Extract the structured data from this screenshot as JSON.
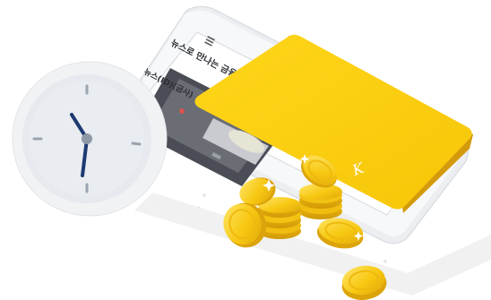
{
  "phone": {
    "screen_title": "뉴스로 만나는 금융",
    "screen_subtitle": "뉴스(ID)(금사)"
  },
  "card": {
    "mark": "K"
  },
  "clock": {
    "hour_hand": "11",
    "minute_hand": "5"
  },
  "colors": {
    "card_yellow": "#f8cf0a",
    "card_edge": "#d8a10e",
    "coin_gold": "#f3c010",
    "coin_light": "#ffe15a",
    "clock_face": "#e8ebef",
    "clock_ring": "#f4f5f7",
    "hand_navy": "#1e3a73",
    "phone_body": "#f3f4f6",
    "shadow": "#ececec"
  },
  "icons": [
    "clock-icon",
    "phone-icon",
    "card-icon",
    "coin-stack-icon"
  ]
}
